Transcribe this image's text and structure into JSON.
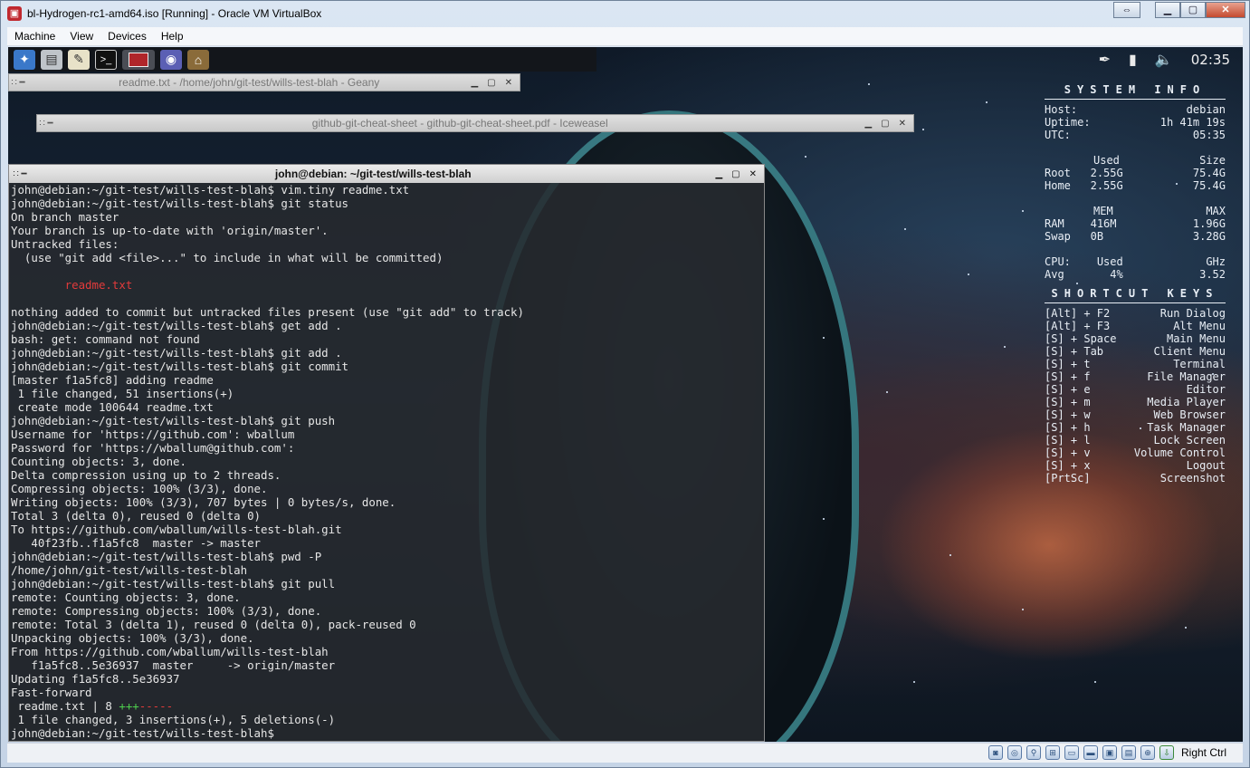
{
  "vbox": {
    "title": "bl-Hydrogen-rc1-amd64.iso [Running] - Oracle VM VirtualBox",
    "menu": [
      "Machine",
      "View",
      "Devices",
      "Help"
    ],
    "host_key": "Right Ctrl"
  },
  "panel": {
    "clock": "02:35",
    "launchers": [
      "settings-icon",
      "file-manager-icon",
      "text-editor-icon",
      "terminal-icon",
      "active-terminal-icon",
      "browser-icon",
      "package-icon"
    ]
  },
  "windows": {
    "geany_title": "readme.txt - /home/john/git-test/wills-test-blah - Geany",
    "iceweasel_title": "github-git-cheat-sheet - github-git-cheat-sheet.pdf - Iceweasel",
    "terminal_title": "john@debian: ~/git-test/wills-test-blah"
  },
  "terminal": {
    "lines": [
      "john@debian:~/git-test/wills-test-blah$ vim.tiny readme.txt",
      "john@debian:~/git-test/wills-test-blah$ git status",
      "On branch master",
      "Your branch is up-to-date with 'origin/master'.",
      "Untracked files:",
      "  (use \"git add <file>...\" to include in what will be committed)",
      "",
      "",
      "",
      "nothing added to commit but untracked files present (use \"git add\" to track)",
      "john@debian:~/git-test/wills-test-blah$ get add .",
      "bash: get: command not found",
      "john@debian:~/git-test/wills-test-blah$ git add .",
      "john@debian:~/git-test/wills-test-blah$ git commit",
      "[master f1a5fc8] adding readme",
      " 1 file changed, 51 insertions(+)",
      " create mode 100644 readme.txt",
      "john@debian:~/git-test/wills-test-blah$ git push",
      "Username for 'https://github.com': wballum",
      "Password for 'https://wballum@github.com':",
      "Counting objects: 3, done.",
      "Delta compression using up to 2 threads.",
      "Compressing objects: 100% (3/3), done.",
      "Writing objects: 100% (3/3), 707 bytes | 0 bytes/s, done.",
      "Total 3 (delta 0), reused 0 (delta 0)",
      "To https://github.com/wballum/wills-test-blah.git",
      "   40f23fb..f1a5fc8  master -> master",
      "john@debian:~/git-test/wills-test-blah$ pwd -P",
      "/home/john/git-test/wills-test-blah",
      "john@debian:~/git-test/wills-test-blah$ git pull",
      "remote: Counting objects: 3, done.",
      "remote: Compressing objects: 100% (3/3), done.",
      "remote: Total 3 (delta 1), reused 0 (delta 0), pack-reused 0",
      "Unpacking objects: 100% (3/3), done.",
      "From https://github.com/wballum/wills-test-blah",
      "   f1a5fc8..5e36937  master     -> origin/master",
      "Updating f1a5fc8..5e36937",
      "Fast-forward",
      "",
      " 1 file changed, 3 insertions(+), 5 deletions(-)",
      "john@debian:~/git-test/wills-test-blah$"
    ],
    "untracked_file": "        readme.txt",
    "diffstat_prefix": " readme.txt | 8 ",
    "diffstat_plus": "+++",
    "diffstat_minus": "-----"
  },
  "conky": {
    "system_title": "SYSTEM INFO",
    "host_label": "Host:",
    "host": "debian",
    "uptime_label": "Uptime:",
    "uptime": "1h 41m 19s",
    "utc_label": "UTC:",
    "utc": "05:35",
    "disk_head_used": "Used",
    "disk_head_size": "Size",
    "root_label": "Root",
    "root_used": "2.55G",
    "root_size": "75.4G",
    "home_label": "Home",
    "home_used": "2.55G",
    "home_size": "75.4G",
    "mem_head": "MEM",
    "max_head": "MAX",
    "ram_label": "RAM",
    "ram_used": "416M",
    "ram_max": "1.96G",
    "swap_label": "Swap",
    "swap_used": "0B",
    "swap_max": "3.28G",
    "cpu_label": "CPU:",
    "cpu_used_head": "Used",
    "ghz_head": "GHz",
    "avg_label": "Avg",
    "avg_used": "4%",
    "avg_ghz": "3.52",
    "shortcuts_title": "SHORTCUT KEYS",
    "shortcuts": [
      {
        "key": "[Alt] + F2",
        "action": "Run Dialog"
      },
      {
        "key": "[Alt] + F3",
        "action": "Alt Menu"
      },
      {
        "key": "[S] + Space",
        "action": "Main Menu"
      },
      {
        "key": "[S] + Tab",
        "action": "Client Menu"
      },
      {
        "key": "[S] + t",
        "action": "Terminal"
      },
      {
        "key": "[S] + f",
        "action": "File Manager"
      },
      {
        "key": "[S] + e",
        "action": "Editor"
      },
      {
        "key": "[S] + m",
        "action": "Media Player"
      },
      {
        "key": "[S] + w",
        "action": "Web Browser"
      },
      {
        "key": "[S] + h",
        "action": "Task Manager"
      },
      {
        "key": "[S] + l",
        "action": "Lock Screen"
      },
      {
        "key": "[S] + v",
        "action": "Volume Control"
      },
      {
        "key": "[S] + x",
        "action": "Logout"
      },
      {
        "key": "[PrtSc]",
        "action": "Screenshot"
      }
    ]
  }
}
